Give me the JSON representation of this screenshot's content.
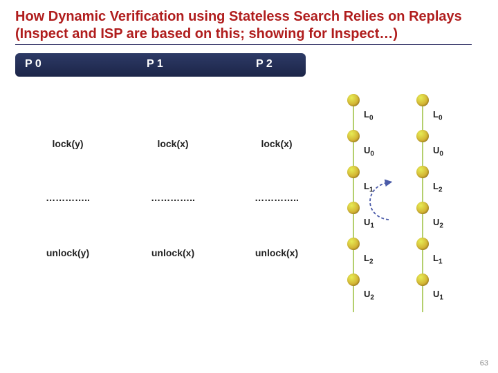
{
  "title": "How Dynamic Verification using Stateless Search Relies on Replays (Inspect and ISP are based on this; showing for Inspect…)",
  "columns": {
    "p0": "P 0",
    "p1": "P 1",
    "p2": "P 2"
  },
  "rows": {
    "p0": [
      "lock(y)",
      "…………..",
      "unlock(y)"
    ],
    "p1": [
      "lock(x)",
      "…………..",
      "unlock(x)"
    ],
    "p2": [
      "lock(x)",
      "…………..",
      "unlock(x)"
    ]
  },
  "traces": {
    "left": [
      "L0",
      "U0",
      "L1",
      "U1",
      "L2",
      "U2"
    ],
    "right": [
      "L0",
      "U0",
      "L2",
      "U2",
      "L1",
      "U1"
    ]
  },
  "page_number": "63"
}
